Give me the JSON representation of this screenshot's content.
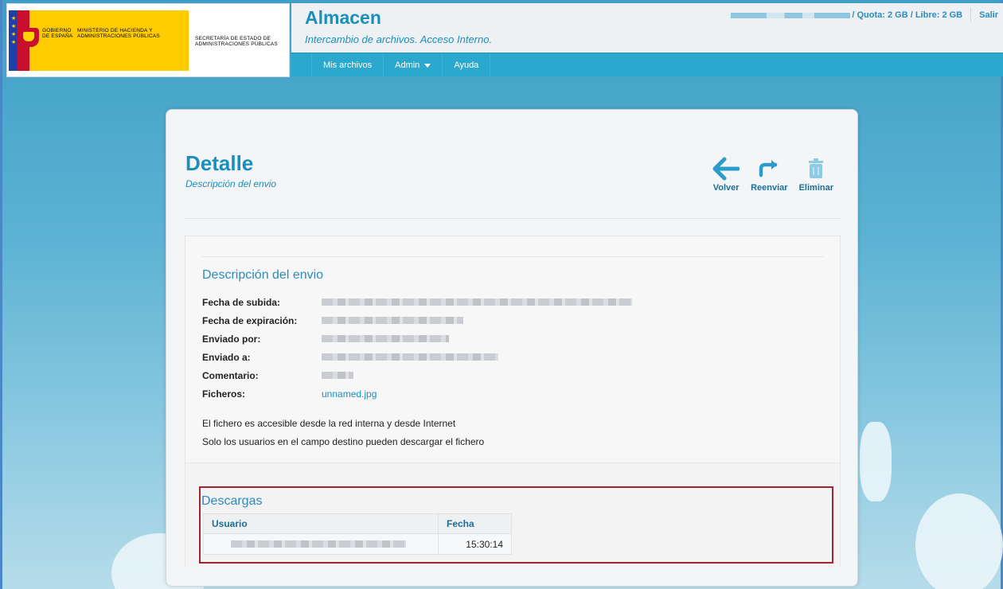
{
  "header": {
    "logo": {
      "line1": "GOBIERNO DE ESPAÑA",
      "line2": "MINISTERIO DE HACIENDA Y ADMINISTRACIONES PÚBLICAS",
      "line3": "SECRETARÍA DE ESTADO DE ADMINISTRACIONES PÚBLICAS"
    },
    "app_title": "Almacen",
    "app_subtitle": "Intercambio de archivos. Acceso Interno.",
    "quota_text": "/ Quota: 2 GB / Libre: 2 GB",
    "logout_label": "Salir"
  },
  "nav": {
    "items": [
      {
        "label": "Mis archivos"
      },
      {
        "label": "Admin"
      },
      {
        "label": "Ayuda"
      }
    ]
  },
  "page": {
    "title": "Detalle",
    "subtitle": "Descripción del envio",
    "actions": {
      "back_label": "Volver",
      "resend_label": "Reenviar",
      "delete_label": "Eliminar"
    }
  },
  "details": {
    "section_title": "Descripción del envio",
    "fields": [
      {
        "label": "Fecha de subida:"
      },
      {
        "label": "Fecha de expiración:"
      },
      {
        "label": "Enviado por:"
      },
      {
        "label": "Enviado a:"
      },
      {
        "label": "Comentario:"
      },
      {
        "label": "Ficheros:",
        "value": "unnamed.jpg"
      }
    ],
    "notes": [
      "El fichero es accesible desde la red interna y desde Internet",
      "Solo los usuarios en el campo destino pueden descargar el fichero"
    ]
  },
  "downloads": {
    "title": "Descargas",
    "columns": [
      "Usuario",
      "Fecha"
    ],
    "rows": [
      {
        "fecha": "15:30:14"
      }
    ]
  },
  "colors": {
    "accent": "#1a8fbd",
    "nav_bg": "#2aa8cd",
    "highlight_border": "#a12430"
  }
}
